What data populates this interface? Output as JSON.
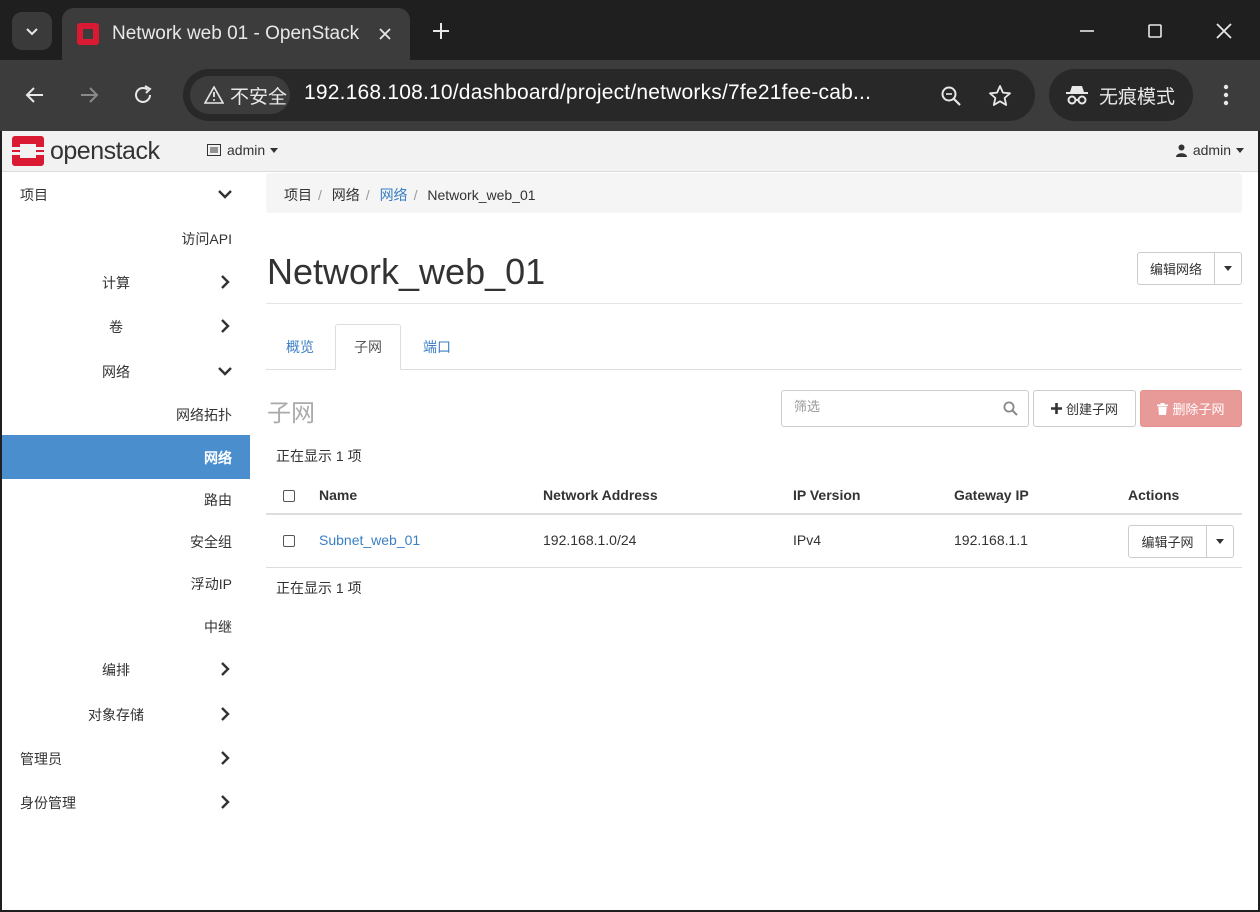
{
  "browser": {
    "tab_title": "Network web 01 - OpenStack",
    "security_label": "不安全",
    "url": "192.168.108.10/dashboard/project/networks/7fe21fee-cab...",
    "incognito_label": "无痕模式"
  },
  "topnav": {
    "brand": "openstack",
    "project": "admin",
    "user": "admin"
  },
  "sidebar": {
    "items": [
      {
        "label": "项目"
      },
      {
        "label": "访问API"
      },
      {
        "label": "计算"
      },
      {
        "label": "卷"
      },
      {
        "label": "网络"
      },
      {
        "label": "网络拓扑"
      },
      {
        "label": "网络"
      },
      {
        "label": "路由"
      },
      {
        "label": "安全组"
      },
      {
        "label": "浮动IP"
      },
      {
        "label": "中继"
      },
      {
        "label": "编排"
      },
      {
        "label": "对象存储"
      },
      {
        "label": "管理员"
      },
      {
        "label": "身份管理"
      }
    ]
  },
  "breadcrumb": [
    "项目",
    "网络",
    "网络",
    "Network_web_01"
  ],
  "page": {
    "title": "Network_web_01",
    "edit_network_label": "编辑网络",
    "tabs": [
      {
        "label": "概览"
      },
      {
        "label": "子网"
      },
      {
        "label": "端口"
      }
    ],
    "section_title": "子网",
    "filter_placeholder": "筛选",
    "create_subnet_label": "创建子网",
    "delete_subnet_label": "删除子网",
    "count_text": "正在显示 1 项"
  },
  "table": {
    "columns": [
      "Name",
      "Network Address",
      "IP Version",
      "Gateway IP",
      "Actions"
    ],
    "rows": [
      {
        "name": "Subnet_web_01",
        "address": "192.168.1.0/24",
        "ip_version": "IPv4",
        "gateway": "192.168.1.1",
        "action": "编辑子网"
      }
    ]
  },
  "colors": {
    "accent": "#4a8ece",
    "link": "#3b7fc4",
    "danger_button": "#e89a98",
    "brand_red": "#da1a32"
  }
}
